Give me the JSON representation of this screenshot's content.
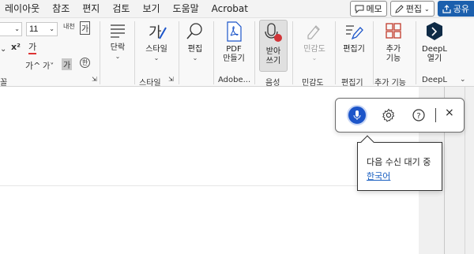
{
  "menubar": {
    "items": [
      "레이아웃",
      "참조",
      "편지",
      "검토",
      "보기",
      "도움말",
      "Acrobat"
    ],
    "memo_label": "메모",
    "edit_label": "편집",
    "share_label": "공유"
  },
  "ribbon": {
    "font_name_value": "",
    "font_size_value": "11",
    "paragraph_label": "단락",
    "style_label": "스타일",
    "style_group": "스타일",
    "edit_label": "편집",
    "pdf_label_1": "PDF",
    "pdf_label_2": "만들기",
    "adobe_group": "Adobe...",
    "dictate_label_1": "받아",
    "dictate_label_2": "쓰기",
    "voice_group": "음성",
    "sensitivity_label": "민감도",
    "sensitivity_group": "민감도",
    "editor_label": "편집기",
    "editor_group": "편집기",
    "addins_label_1": "추가",
    "addins_label_2": "기능",
    "addins_group": "추가 기능",
    "deepl_label_1": "DeepL",
    "deepl_label_2": "열기",
    "deepl_group": "DeepL",
    "font_group_partial": "꼴"
  },
  "dictation": {
    "tooltip_text": "다음 수신 대기 중",
    "language_link": "한국어"
  },
  "colors": {
    "accent": "#1c55c9",
    "share": "#1b5fad",
    "link": "#1a5fc1"
  }
}
